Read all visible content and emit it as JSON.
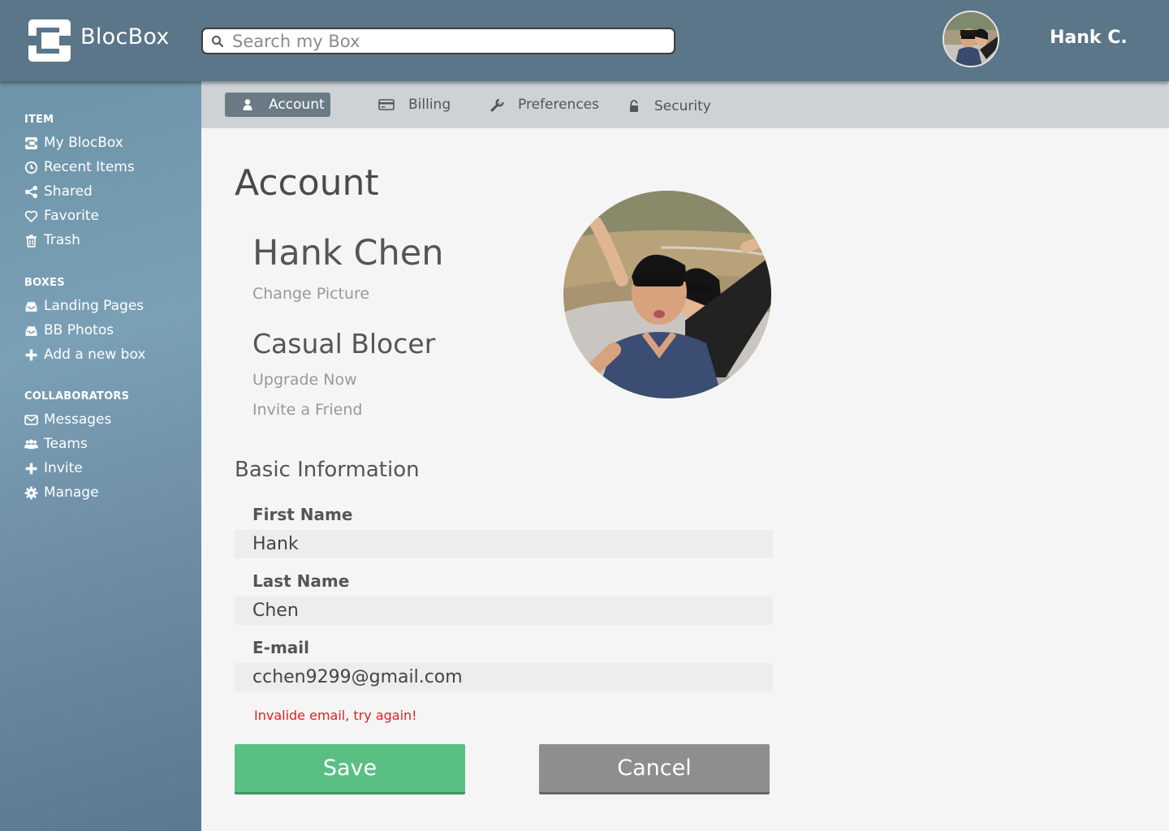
{
  "app": {
    "name": "BlocBox"
  },
  "search": {
    "placeholder": "Search my Box"
  },
  "user": {
    "short_name": "Hank C."
  },
  "sidebar": {
    "sections": [
      {
        "title": "ITEM",
        "items": [
          {
            "label": "My BlocBox",
            "icon": "blocbox-icon"
          },
          {
            "label": "Recent Items",
            "icon": "clock-icon"
          },
          {
            "label": "Shared",
            "icon": "share-icon"
          },
          {
            "label": "Favorite",
            "icon": "heart-icon"
          },
          {
            "label": "Trash",
            "icon": "trash-icon"
          }
        ]
      },
      {
        "title": "BOXES",
        "items": [
          {
            "label": "Landing Pages",
            "icon": "inbox-icon"
          },
          {
            "label": "BB Photos",
            "icon": "inbox-icon"
          },
          {
            "label": "Add a new box",
            "icon": "plus-icon"
          }
        ]
      },
      {
        "title": "COLLABORATORS",
        "items": [
          {
            "label": "Messages",
            "icon": "envelope-icon"
          },
          {
            "label": "Teams",
            "icon": "users-icon"
          },
          {
            "label": "Invite",
            "icon": "plus-icon"
          },
          {
            "label": "Manage",
            "icon": "gear-icon"
          }
        ]
      }
    ]
  },
  "tabs": [
    {
      "label": "Account",
      "icon": "user-icon",
      "active": true
    },
    {
      "label": "Billing",
      "icon": "credit-card-icon",
      "active": false
    },
    {
      "label": "Preferences",
      "icon": "wrench-icon",
      "active": false
    },
    {
      "label": "Security",
      "icon": "lock-icon",
      "active": false
    }
  ],
  "account": {
    "title": "Account",
    "full_name": "Hank Chen",
    "change_picture": "Change Picture",
    "plan": "Casual Blocer",
    "upgrade": "Upgrade Now",
    "invite": "Invite a Friend"
  },
  "basic_info": {
    "heading": "Basic Information",
    "first_name_label": "First Name",
    "first_name": "Hank",
    "last_name_label": "Last Name",
    "last_name": "Chen",
    "email_label": "E-mail",
    "email": "cchen9299@gmail.com",
    "error": "Invalide email, try again!"
  },
  "actions": {
    "save": "Save",
    "cancel": "Cancel"
  },
  "colors": {
    "header": "#5a7688",
    "sidebar": "#7aa0b6",
    "tabbar": "#ccd2d6",
    "active_tab": "#6a7b85",
    "save": "#5abf83",
    "cancel": "#8e8e8e",
    "error": "#e02020"
  }
}
